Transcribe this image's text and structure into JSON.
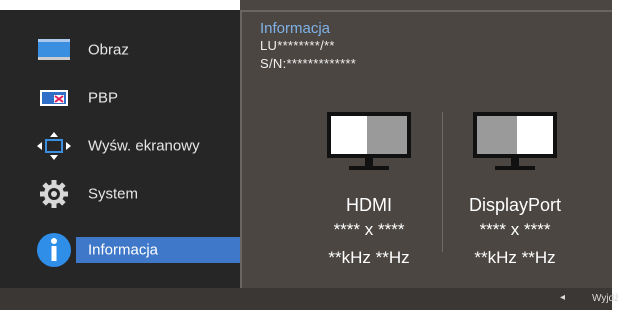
{
  "sidebar": {
    "items": [
      {
        "label": "Obraz",
        "icon": "monitor-icon"
      },
      {
        "label": "PBP",
        "icon": "pbp-icon"
      },
      {
        "label": "Wyśw. ekranowy",
        "icon": "osd-arrows-icon"
      },
      {
        "label": "System",
        "icon": "gear-icon"
      },
      {
        "label": "Informacja",
        "icon": "info-icon",
        "active": true
      }
    ]
  },
  "panel": {
    "title": "Informacja",
    "model": "LU********/**",
    "serial": "S/N:*************",
    "sources": [
      {
        "label": "HDMI",
        "resolution": "**** x ****",
        "frequency": "**kHz **Hz"
      },
      {
        "label": "DisplayPort",
        "resolution": "**** x ****",
        "frequency": "**kHz **Hz"
      }
    ]
  },
  "footer": {
    "arrow": "◂",
    "exit_label": "Wyjdź"
  },
  "colors": {
    "background": "#4b4642",
    "sidebar": "#262626",
    "accent_blue": "#3f78c8",
    "title_blue": "#7fb2e8"
  }
}
